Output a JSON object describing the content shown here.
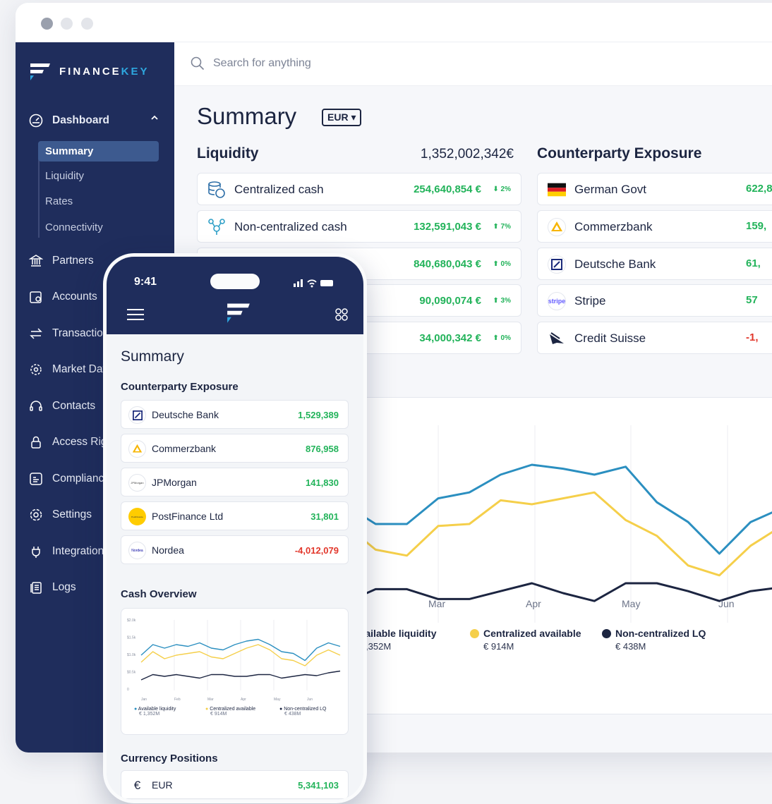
{
  "app": {
    "logo_a": "FINANCE",
    "logo_b": "KEY"
  },
  "search": {
    "placeholder": "Search for anything"
  },
  "sidebar": {
    "dashboard": "Dashboard",
    "sub_items": [
      "Summary",
      "Liquidity",
      "Rates",
      "Connectivity"
    ],
    "items": [
      "Partners",
      "Accounts",
      "Transactions",
      "Market Data",
      "Contacts",
      "Access Rights",
      "Compliance",
      "Settings",
      "Integrations",
      "Logs"
    ]
  },
  "main": {
    "title": "Summary",
    "currency": "EUR ▾",
    "liquidity": {
      "heading": "Liquidity",
      "total": "1,352,002,342€",
      "rows": [
        {
          "label": "Centralized cash",
          "value": "254,640,854 €",
          "change": "⬇ 2%"
        },
        {
          "label": "Non-centralized cash",
          "value": "132,591,043 €",
          "change": "⬆ 7%"
        },
        {
          "label": "",
          "value": "840,680,043 €",
          "change": "⬆ 0%"
        },
        {
          "label": "",
          "value": "90,090,074 €",
          "change": "⬆ 3%"
        },
        {
          "label": "",
          "value": "34,000,342 €",
          "change": "⬆ 0%"
        }
      ]
    },
    "exposure": {
      "heading": "Counterparty Exposure",
      "rows": [
        {
          "label": "German Govt",
          "value": "622,8",
          "color": "#22b35a"
        },
        {
          "label": "Commerzbank",
          "value": "159,",
          "color": "#22b35a"
        },
        {
          "label": "Deutsche Bank",
          "value": "61,",
          "color": "#22b35a"
        },
        {
          "label": "Stripe",
          "value": "57",
          "color": "#22b35a"
        },
        {
          "label": "Credit Suisse",
          "value": "-1,",
          "color": "#e2372b"
        }
      ]
    }
  },
  "chart_data": [
    {
      "type": "line",
      "x": [
        "",
        "Mar",
        "Apr",
        "May",
        "Jun"
      ],
      "series": [
        {
          "name": "Available liquidity",
          "color": "#2b8fc0",
          "values": [
            0.6,
            0.5,
            0.5,
            0.63,
            0.66,
            0.75,
            0.8,
            0.78,
            0.75,
            0.79,
            0.61,
            0.51,
            0.35,
            0.51,
            0.58
          ]
        },
        {
          "name": "Centralized available",
          "color": "#f5cf4a",
          "values": [
            0.5,
            0.37,
            0.34,
            0.49,
            0.5,
            0.62,
            0.6,
            0.63,
            0.66,
            0.52,
            0.44,
            0.29,
            0.24,
            0.39,
            0.49
          ]
        },
        {
          "name": "Non-centralized LQ",
          "color": "#1c2541",
          "values": [
            0.1,
            0.17,
            0.17,
            0.12,
            0.12,
            0.16,
            0.2,
            0.15,
            0.11,
            0.2,
            0.2,
            0.16,
            0.11,
            0.16,
            0.18
          ]
        }
      ],
      "legend": [
        {
          "name": "Available liquidity",
          "sub": "€ 1,352M"
        },
        {
          "name": "Centralized available",
          "sub": "€ 914M"
        },
        {
          "name": "Non-centralized LQ",
          "sub": "€ 438M"
        }
      ]
    },
    {
      "type": "line",
      "title": "Cash Overview",
      "y_ticks": [
        "$2.0k",
        "$1.5k",
        "$1.0k",
        "$0.5k",
        "0"
      ],
      "x": [
        "Jan",
        "Feb",
        "Mar",
        "Apr",
        "May",
        "Jun"
      ],
      "series": [
        {
          "name": "Available liquidity",
          "color": "#2b8fc0",
          "values": [
            1.0,
            1.3,
            1.2,
            1.3,
            1.25,
            1.35,
            1.2,
            1.15,
            1.3,
            1.4,
            1.45,
            1.3,
            1.1,
            1.05,
            0.85,
            1.2,
            1.35,
            1.25
          ]
        },
        {
          "name": "Centralized available",
          "color": "#f5cf4a",
          "values": [
            0.8,
            1.1,
            0.9,
            1.0,
            1.05,
            1.1,
            0.95,
            0.9,
            1.05,
            1.2,
            1.3,
            1.15,
            0.9,
            0.85,
            0.7,
            1.0,
            1.15,
            1.0
          ]
        },
        {
          "name": "Non-centralized LQ",
          "color": "#1c2541",
          "values": [
            0.3,
            0.45,
            0.4,
            0.45,
            0.4,
            0.35,
            0.45,
            0.45,
            0.4,
            0.4,
            0.45,
            0.45,
            0.35,
            0.4,
            0.45,
            0.42,
            0.5,
            0.55
          ]
        }
      ],
      "legend": [
        {
          "name": "Available liquidity",
          "sub": "€ 1,352M"
        },
        {
          "name": "Centralized available",
          "sub": "€ 914M"
        },
        {
          "name": "Non-centralized LQ",
          "sub": "€ 438M"
        }
      ]
    }
  ],
  "phone": {
    "time": "9:41",
    "title": "Summary",
    "exposure_heading": "Counterparty Exposure",
    "exposure": [
      {
        "label": "Deutsche Bank",
        "value": "1,529,389",
        "color": "#22b35a"
      },
      {
        "label": "Commerzbank",
        "value": "876,958",
        "color": "#22b35a"
      },
      {
        "label": "JPMorgan",
        "value": "141,830",
        "color": "#22b35a"
      },
      {
        "label": "PostFinance Ltd",
        "value": "31,801",
        "color": "#22b35a"
      },
      {
        "label": "Nordea",
        "value": "-4,012,079",
        "color": "#e2372b"
      }
    ],
    "cash_heading": "Cash Overview",
    "currency_heading": "Currency Positions",
    "currency_row": {
      "label": "EUR",
      "value": "5,341,103"
    },
    "logo_labels": {
      "jpm": "JPMorgan",
      "post": "PostFinance",
      "nordea": "Nordea",
      "stripe": "stripe"
    }
  }
}
